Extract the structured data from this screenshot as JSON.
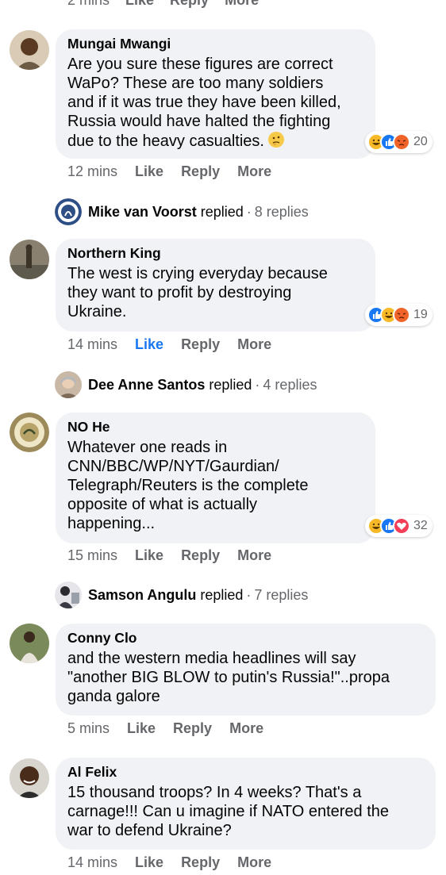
{
  "top_actions": {
    "time": "2 mins",
    "like": "Like",
    "reply": "Reply",
    "more": "More"
  },
  "comments": [
    {
      "author": "Mungai Mwangi",
      "text": "Are you sure these figures are correct\nWaPo? These are too many soldiers\nand if it was true they have been killed,\nRussia would have halted the fighting\ndue to the heavy casualties.",
      "inline_emoji": "thinking-face",
      "reactions": [
        "haha",
        "like",
        "angry"
      ],
      "reaction_count": "20",
      "time": "12 mins",
      "like": "Like",
      "reply": "Reply",
      "more": "More"
    },
    {
      "author": "Northern King",
      "text": "The west is crying everyday because\nthey want to profit by destroying\nUkraine.",
      "reactions": [
        "like",
        "haha",
        "angry"
      ],
      "reaction_count": "19",
      "time": "14 mins",
      "like": "Like",
      "reply": "Reply",
      "more": "More",
      "liked": true
    },
    {
      "author": "NO He",
      "text": "Whatever one reads in\nCNN/BBC/WP/NYT/Gaurdian/\nTelegraph/Reuters is the complete\nopposite of what is actually\nhappening...",
      "reactions": [
        "haha",
        "like",
        "love"
      ],
      "reaction_count": "32",
      "time": "15 mins",
      "like": "Like",
      "reply": "Reply",
      "more": "More"
    },
    {
      "author": "Conny Clo",
      "text": "and the western media headlines will say\n\"another BIG BLOW to putin's Russia!\"..propa\nganda galore",
      "time": "5 mins",
      "like": "Like",
      "reply": "Reply",
      "more": "More"
    },
    {
      "author": "Al Felix",
      "text": "15 thousand troops? In 4 weeks? That's a\ncarnage!!! Can u imagine if NATO entered the\nwar to defend Ukraine?",
      "time": "14 mins",
      "like": "Like",
      "reply": "Reply",
      "more": "More"
    }
  ],
  "replies": [
    {
      "name": "Mike van Voorst",
      "verb": "replied",
      "dot": "·",
      "count": "8 replies"
    },
    {
      "name": "Dee Anne Santos",
      "verb": "replied",
      "dot": "·",
      "count": "4 replies"
    },
    {
      "name": "Samson Angulu",
      "verb": "replied",
      "dot": "·",
      "count": "7 replies"
    }
  ],
  "colors": {
    "bubble": "#f0f2f5",
    "meta": "#65676b",
    "like_blue": "#1877f2",
    "angry_orange": "#f0642a",
    "love_red": "#f33e58",
    "haha_yellow": "#f7b928"
  }
}
